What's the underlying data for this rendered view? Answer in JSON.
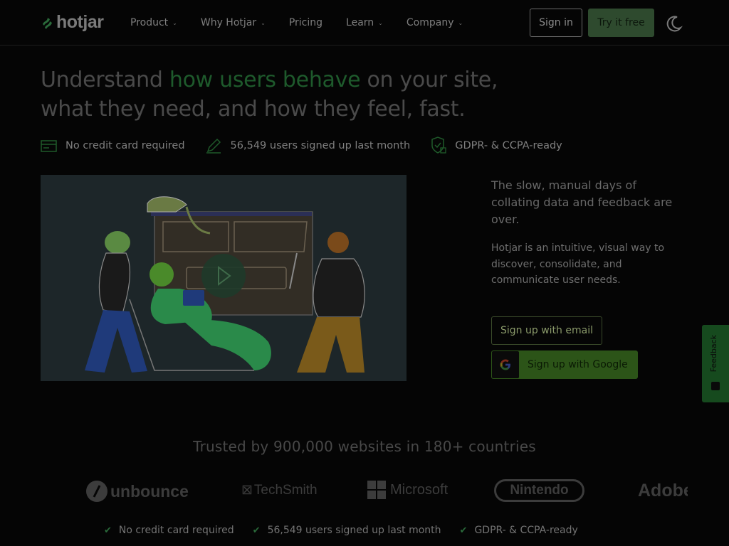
{
  "header": {
    "logo_text": "hotjar",
    "nav": [
      {
        "label": "Product",
        "has_menu": true
      },
      {
        "label": "Why Hotjar",
        "has_menu": true
      },
      {
        "label": "Pricing",
        "has_menu": false
      },
      {
        "label": "Learn",
        "has_menu": true
      },
      {
        "label": "Company",
        "has_menu": true
      }
    ],
    "signin_label": "Sign in",
    "try_label": "Try it free",
    "theme_icon": "moon-icon"
  },
  "hero": {
    "title_part1": "Understand ",
    "title_accent": "how users behave",
    "title_part2": " on your site, what they need, and how they feel, fast.",
    "perks": [
      {
        "icon": "credit-card-icon",
        "text": "No credit card required"
      },
      {
        "icon": "pencil-icon",
        "text": "56,549 users signed up last month"
      },
      {
        "icon": "shield-check-icon",
        "text": "GDPR- & CCPA-ready"
      }
    ]
  },
  "side": {
    "heading": "The slow, manual days of collating data and feedback are over.",
    "body": "Hotjar is an intuitive, visual way to discover, consolidate, and communicate user needs.",
    "email_button": "Sign up with email",
    "google_button": "Sign up with Google"
  },
  "feedback_tab": {
    "label": "Feedback"
  },
  "trusted": {
    "heading": "Trusted by 900,000 websites in 180+ countries",
    "logos": [
      "unbounce",
      "TechSmith",
      "Microsoft",
      "Nintendo",
      "Adobe"
    ]
  },
  "bottom_perks": [
    "No credit card required",
    "56,549 users signed up last month",
    "GDPR- & CCPA-ready"
  ],
  "colors": {
    "background": "#050505",
    "accent_green": "#1e5a2c",
    "try_button": "#2e4a2e",
    "google_button": "#2c5418",
    "feedback_tab": "#164a1e"
  }
}
